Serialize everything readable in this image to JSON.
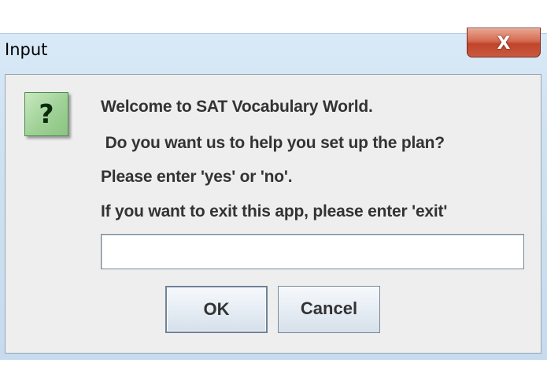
{
  "window": {
    "title": "Input",
    "close_glyph": "X"
  },
  "dialog": {
    "icon": "question-icon",
    "icon_glyph": "?",
    "message_lines": [
      "Welcome to SAT Vocabulary World.",
      " Do you want us to help you set up the plan?",
      "Please enter 'yes' or 'no'.",
      "If you want to exit this app, please enter 'exit'"
    ],
    "input_value": "",
    "ok_label": "OK",
    "cancel_label": "Cancel"
  },
  "colors": {
    "window_frame": "#cfe2f3",
    "content_background": "#eeeeee",
    "close_button": "#c8503a",
    "icon_green": "#9fd196",
    "text": "#333333"
  }
}
